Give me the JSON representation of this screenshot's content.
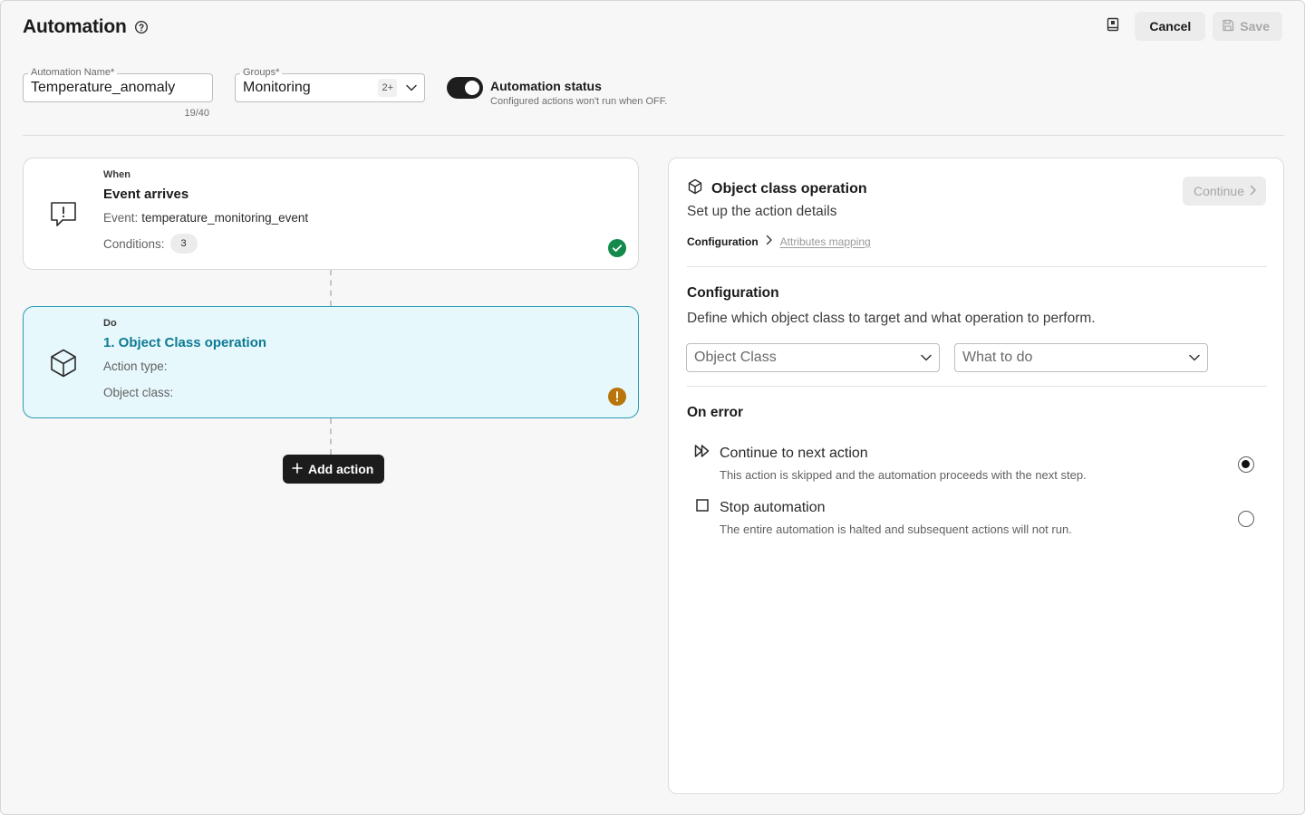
{
  "header": {
    "title": "Automation",
    "cancel_label": "Cancel",
    "save_label": "Save"
  },
  "form": {
    "name_label": "Automation Name*",
    "name_value": "Temperature_anomaly",
    "name_counter": "19/40",
    "groups_label": "Groups*",
    "groups_value": "Monitoring",
    "groups_more": "2+",
    "status_title": "Automation status",
    "status_subtitle": "Configured actions won't run when OFF.",
    "status_on": true
  },
  "flow": {
    "trigger": {
      "eyebrow": "When",
      "title": "Event arrives",
      "event_label": "Event:",
      "event_value": "temperature_monitoring_event",
      "conditions_label": "Conditions:",
      "conditions_count": "3",
      "status": "valid"
    },
    "action": {
      "eyebrow": "Do",
      "title": "1. Object Class operation",
      "action_type_label": "Action type:",
      "object_class_label": "Object class:",
      "status": "warning"
    },
    "add_action_label": "Add action"
  },
  "panel": {
    "title": "Object class operation",
    "subtitle": "Set up the action details",
    "continue_label": "Continue",
    "breadcrumb": {
      "current": "Configuration",
      "next": "Attributes mapping"
    },
    "configuration": {
      "title": "Configuration",
      "subtitle": "Define which object class to target and what operation to perform.",
      "object_class_placeholder": "Object Class",
      "what_to_do_placeholder": "What to do"
    },
    "on_error": {
      "title": "On error",
      "options": [
        {
          "label": "Continue to next action",
          "description": "This action is skipped and the automation proceeds with the next step.",
          "selected": true
        },
        {
          "label": "Stop automation",
          "description": "The entire automation is halted and subsequent actions will not run.",
          "selected": false
        }
      ]
    }
  },
  "colors": {
    "accent": "#0d7a93",
    "active_card_bg": "#e7f8fc",
    "active_card_border": "#2a9bb2",
    "success": "#138a4b",
    "warning": "#b8760a",
    "primary_dark": "#1c1c1c"
  }
}
